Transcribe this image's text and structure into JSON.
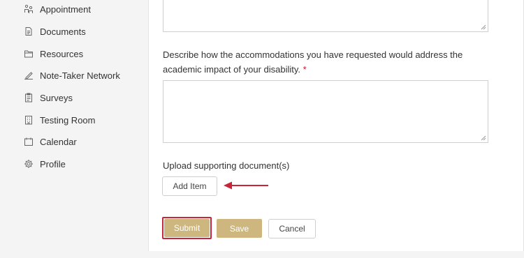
{
  "sidebar": {
    "items": [
      {
        "label": "Appointment",
        "icon": "people-icon"
      },
      {
        "label": "Documents",
        "icon": "document-icon"
      },
      {
        "label": "Resources",
        "icon": "folder-icon"
      },
      {
        "label": "Note-Taker Network",
        "icon": "pen-icon"
      },
      {
        "label": "Surveys",
        "icon": "clipboard-icon"
      },
      {
        "label": "Testing Room",
        "icon": "building-icon"
      },
      {
        "label": "Calendar",
        "icon": "calendar-icon"
      },
      {
        "label": "Profile",
        "icon": "gear-icon"
      }
    ]
  },
  "form": {
    "accommodation_question": "Describe how the accommodations you have requested would address the academic impact of your disability.",
    "required_marker": "*",
    "upload_label": "Upload supporting document(s)",
    "add_item_label": "Add Item"
  },
  "actions": {
    "submit_label": "Submit",
    "save_label": "Save",
    "cancel_label": "Cancel"
  },
  "colors": {
    "accent_gold": "#cdb77f",
    "required_red": "#c8102e",
    "annotation_red": "#c8243a"
  }
}
